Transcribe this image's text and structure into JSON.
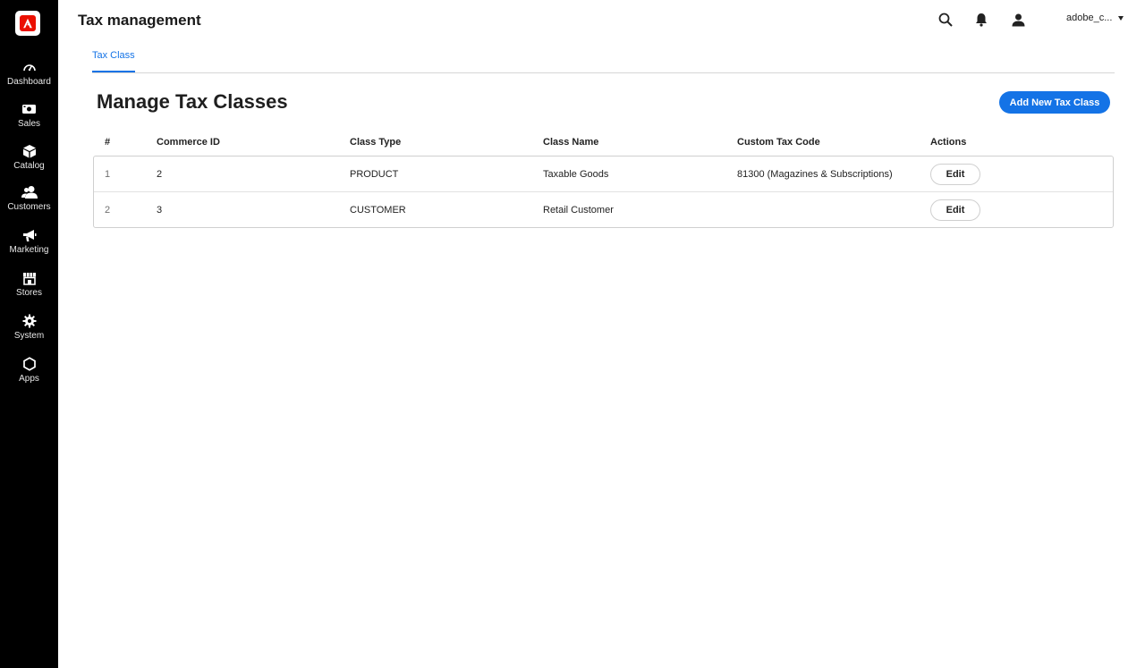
{
  "sidebar": {
    "items": [
      {
        "label": "Dashboard",
        "icon": "dashboard-icon"
      },
      {
        "label": "Sales",
        "icon": "sales-icon"
      },
      {
        "label": "Catalog",
        "icon": "catalog-icon"
      },
      {
        "label": "Customers",
        "icon": "customers-icon"
      },
      {
        "label": "Marketing",
        "icon": "marketing-icon"
      },
      {
        "label": "Stores",
        "icon": "stores-icon"
      },
      {
        "label": "System",
        "icon": "gear-icon"
      },
      {
        "label": "Apps",
        "icon": "hexagon-icon"
      }
    ]
  },
  "header": {
    "title": "Tax management",
    "user": "adobe_c..."
  },
  "tabs": [
    {
      "label": "Tax Class",
      "active": true
    }
  ],
  "main": {
    "heading": "Manage Tax Classes",
    "add_button": "Add New Tax Class"
  },
  "table": {
    "columns": [
      "#",
      "Commerce ID",
      "Class Type",
      "Class Name",
      "Custom Tax Code",
      "Actions"
    ],
    "rows": [
      {
        "index": "1",
        "commerce_id": "2",
        "class_type": "PRODUCT",
        "class_name": "Taxable Goods",
        "custom_tax_code": "81300 (Magazines & Subscriptions)",
        "action": "Edit"
      },
      {
        "index": "2",
        "commerce_id": "3",
        "class_type": "CUSTOMER",
        "class_name": "Retail Customer",
        "custom_tax_code": "",
        "action": "Edit"
      }
    ]
  },
  "colors": {
    "sidebar_bg": "#000000",
    "accent": "#1473e6",
    "logo_red": "#eb1000"
  }
}
